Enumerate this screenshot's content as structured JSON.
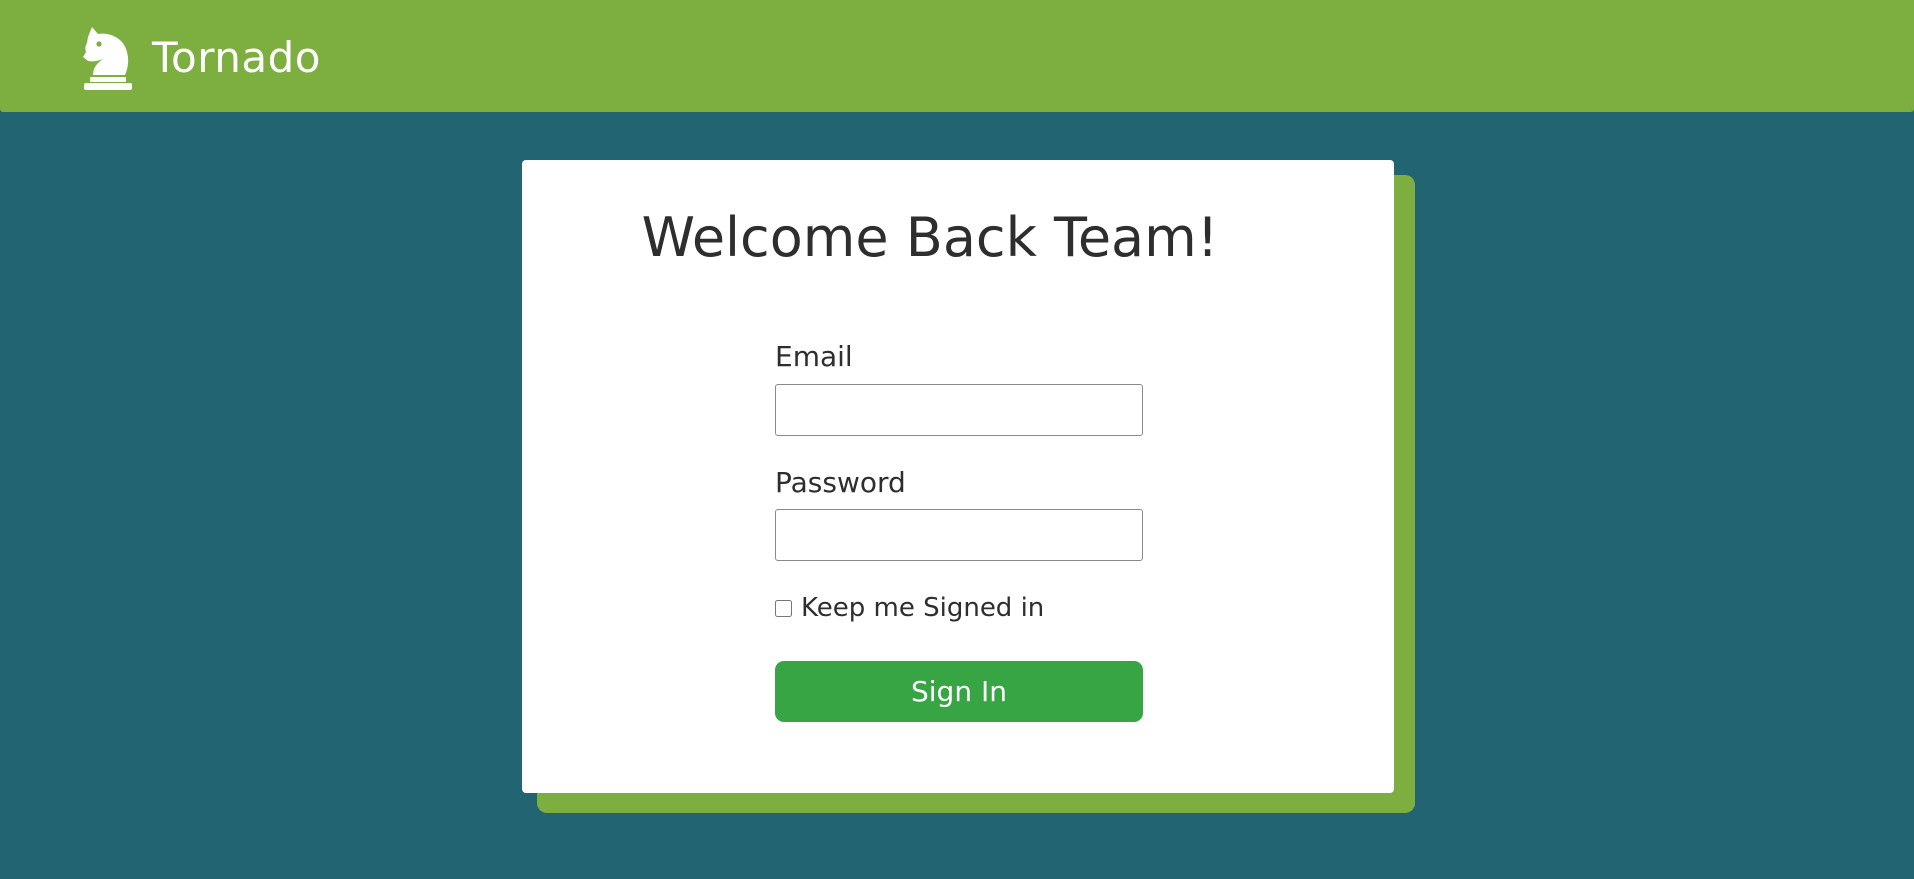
{
  "header": {
    "brand_icon": "chess-knight-icon",
    "brand_name": "Tornado"
  },
  "login": {
    "title": "Welcome Back Team!",
    "email_label": "Email",
    "email_value": "",
    "password_label": "Password",
    "password_value": "",
    "keep_signed_in_label": "Keep me Signed in",
    "keep_signed_in_checked": false,
    "submit_label": "Sign In"
  },
  "colors": {
    "header_background": "#7cae40",
    "page_background": "#236473",
    "card_background": "#ffffff",
    "card_shadow": "#7cae40",
    "button_background": "#38a544",
    "text": "#2e2e2e"
  }
}
